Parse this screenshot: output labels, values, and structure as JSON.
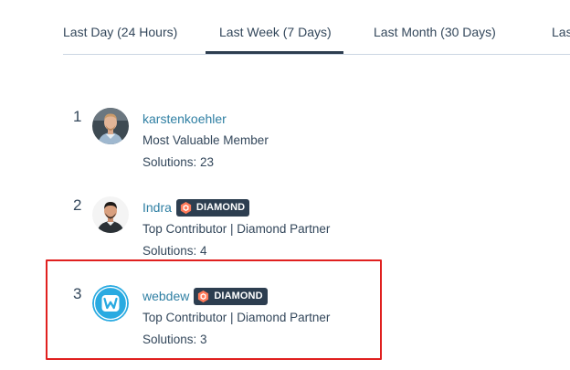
{
  "tabs": [
    {
      "label": "Last Day (24 Hours)",
      "active": false
    },
    {
      "label": "Last Week (7 Days)",
      "active": true
    },
    {
      "label": "Last Month (30 Days)",
      "active": false
    },
    {
      "label": "Las",
      "active": false
    }
  ],
  "leaderboard": [
    {
      "rank": "1",
      "username": "karstenkoehler",
      "badge": "",
      "role": "Most Valuable Member",
      "solutions": "Solutions: 23",
      "avatar_icon": "person-photo-avatar"
    },
    {
      "rank": "2",
      "username": "Indra",
      "badge": "DIAMOND",
      "role": "Top Contributor | Diamond Partner",
      "solutions": "Solutions: 4",
      "avatar_icon": "person-photo-avatar"
    },
    {
      "rank": "3",
      "username": "webdew",
      "badge": "DIAMOND",
      "role": "Top Contributor | Diamond Partner",
      "solutions": "Solutions: 3",
      "avatar_icon": "webdew-logo-avatar"
    }
  ],
  "colors": {
    "link": "#2f7fa3",
    "text": "#33475b",
    "badge_bg": "#2d3e50",
    "badge_icon": "#ff7a59",
    "highlight": "#e0201f",
    "webdew_blue": "#29aae1"
  }
}
